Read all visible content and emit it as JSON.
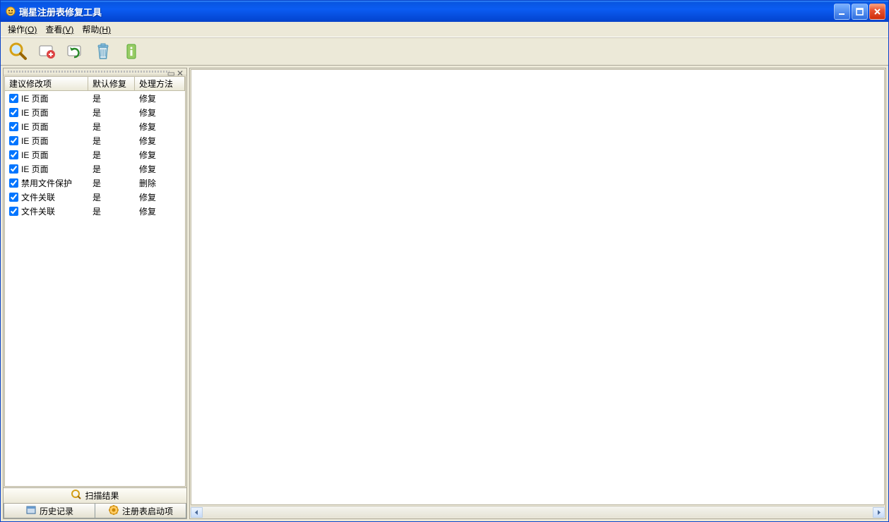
{
  "window": {
    "title": "瑞星注册表修复工具"
  },
  "menu": {
    "op": "操作",
    "op_u": "(O)",
    "view": "查看",
    "view_u": "(V)",
    "help": "帮助",
    "help_u": "(H)"
  },
  "columns": {
    "c1": "建议修改项",
    "c2": "默认修复",
    "c3": "处理方法"
  },
  "rows": [
    {
      "name": "IE 页面",
      "def": "是",
      "act": "修复",
      "checked": true
    },
    {
      "name": "IE 页面",
      "def": "是",
      "act": "修复",
      "checked": true
    },
    {
      "name": "IE 页面",
      "def": "是",
      "act": "修复",
      "checked": true
    },
    {
      "name": "IE 页面",
      "def": "是",
      "act": "修复",
      "checked": true
    },
    {
      "name": "IE 页面",
      "def": "是",
      "act": "修复",
      "checked": true
    },
    {
      "name": "IE 页面",
      "def": "是",
      "act": "修复",
      "checked": true
    },
    {
      "name": "禁用文件保护",
      "def": "是",
      "act": "删除",
      "checked": true
    },
    {
      "name": "文件关联",
      "def": "是",
      "act": "修复",
      "checked": true
    },
    {
      "name": "文件关联",
      "def": "是",
      "act": "修复",
      "checked": true
    }
  ],
  "tabs": {
    "active": "扫描结果",
    "history": "历史记录",
    "startup": "注册表启动项"
  }
}
